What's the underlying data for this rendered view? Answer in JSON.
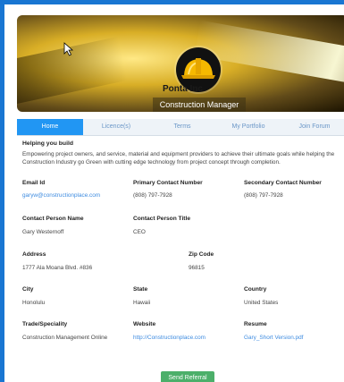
{
  "header": {
    "company_name": "Ponta Inc",
    "role": "Construction Manager"
  },
  "tabs": [
    {
      "label": "Home"
    },
    {
      "label": "Licence(s)"
    },
    {
      "label": "Terms"
    },
    {
      "label": "My Portfolio"
    },
    {
      "label": "Join Forum"
    }
  ],
  "section": {
    "title": "Helping you build",
    "description": "Empowering project owners, and service, material and equipment providers to achieve their ultimate goals while helping the Construction Industry go Green with cutting edge technology from project concept through completion."
  },
  "fields": {
    "email": {
      "label": "Email Id",
      "value": "garyw@constructionplace.com"
    },
    "primary_phone": {
      "label": "Primary Contact Number",
      "value": "(808) 797-7928"
    },
    "secondary_phone": {
      "label": "Secondary Contact Number",
      "value": "(808) 797-7928"
    },
    "contact_name": {
      "label": "Contact Person Name",
      "value": "Gary Westernoff"
    },
    "contact_title": {
      "label": "Contact Person Title",
      "value": "CEO"
    },
    "address": {
      "label": "Address",
      "value": "1777 Ala Moana Blvd. #836"
    },
    "zip": {
      "label": "Zip Code",
      "value": "96815"
    },
    "city": {
      "label": "City",
      "value": "Honolulu"
    },
    "state": {
      "label": "State",
      "value": "Hawaii"
    },
    "country": {
      "label": "Country",
      "value": "United States"
    },
    "trade": {
      "label": "Trade/Speciality",
      "value": "Construction Management Online"
    },
    "website": {
      "label": "Website",
      "value": "http://Constructionplace.com"
    },
    "resume": {
      "label": "Resume",
      "value": "Gary_Short Version.pdf"
    }
  },
  "actions": {
    "send_referral": "Send Referral"
  }
}
